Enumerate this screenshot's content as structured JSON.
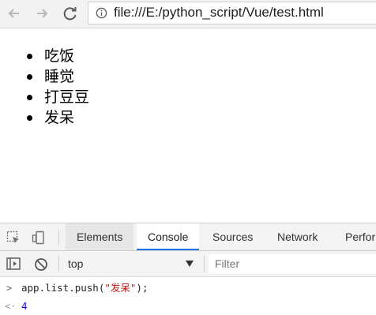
{
  "browser": {
    "url": "file:///E:/python_script/Vue/test.html"
  },
  "page": {
    "items": [
      "吃饭",
      "睡觉",
      "打豆豆",
      "发呆"
    ]
  },
  "devtools": {
    "tabs": [
      "Elements",
      "Console",
      "Sources",
      "Network",
      "Perfor"
    ],
    "active_tab": "Console",
    "context": "top",
    "filter_placeholder": "Filter",
    "console": {
      "command_prefix": "app.list.push(",
      "command_string": "\"发呆\"",
      "command_suffix": ");",
      "result": "4"
    }
  },
  "colors": {
    "accent": "#1a73e8",
    "string": "#c41a16",
    "number": "#1c00cf"
  }
}
